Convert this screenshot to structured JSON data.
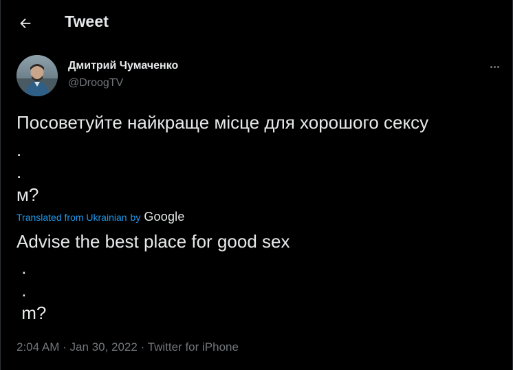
{
  "header": {
    "title": "Tweet",
    "back_icon": "arrow-left-icon"
  },
  "author": {
    "name": "Дмитрий Чумаченко",
    "handle": "@DroogTV",
    "avatar_icon": "user-avatar"
  },
  "more_icon": "more-horizontal-icon",
  "tweet": {
    "original_lines": [
      "Посоветуйте найкраще місце для хорошого сексу",
      ".",
      ".",
      "м?"
    ],
    "translation_label": "Translated from Ukrainian",
    "translation_by": "by",
    "translation_provider": "Google",
    "translated_lines": [
      "Advise the best place for good sex",
      " .",
      " .",
      " m?"
    ]
  },
  "meta": {
    "time": "2:04 AM",
    "separator": "·",
    "date": "Jan 30, 2022",
    "source": "Twitter for iPhone"
  },
  "colors": {
    "background": "#000000",
    "text": "#e7e9ea",
    "muted": "#71767b",
    "link": "#1d9bf0"
  }
}
